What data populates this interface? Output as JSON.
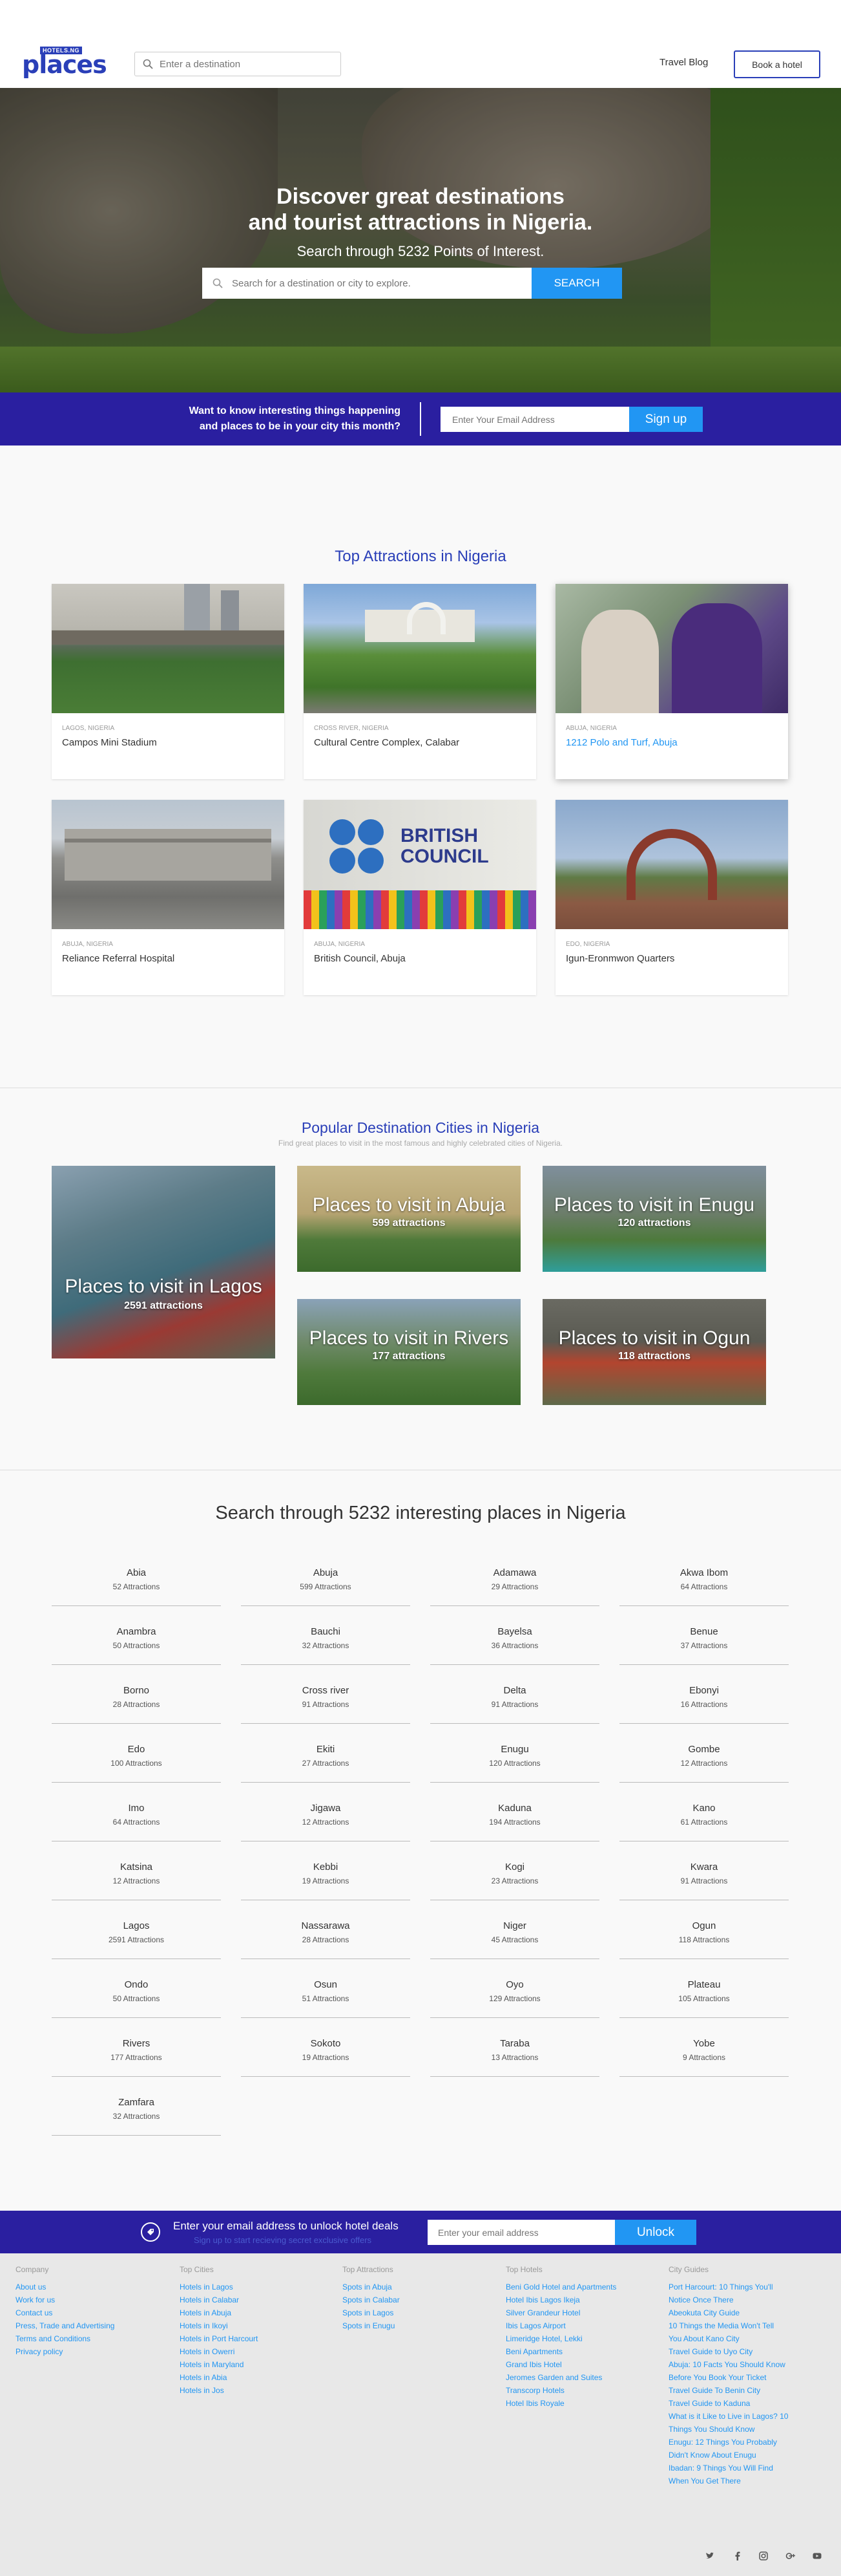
{
  "header": {
    "logo_badge": "HOTELS.NG",
    "logo_text": "places",
    "search_placeholder": "Enter a destination",
    "nav_blog": "Travel Blog",
    "book_hotel": "Book a hotel"
  },
  "hero": {
    "title_line1": "Discover great destinations",
    "title_line2": "and tourist attractions in Nigeria.",
    "subtitle": "Search through 5232 Points of Interest.",
    "search_placeholder": "Search for a destination or city to explore.",
    "search_button": "SEARCH"
  },
  "newsletter": {
    "text_line1": "Want to know interesting things happening",
    "text_line2": "and places to be in your city this month?",
    "input_placeholder": "Enter Your Email Address",
    "button": "Sign up"
  },
  "top_attractions": {
    "title": "Top Attractions in Nigeria",
    "cards": [
      {
        "location": "LAGOS, NIGERIA",
        "name": "Campos Mini Stadium"
      },
      {
        "location": "CROSS RIVER, NIGERIA",
        "name": "Cultural Centre Complex, Calabar"
      },
      {
        "location": "ABUJA, NIGERIA",
        "name": "1212 Polo and Turf, Abuja"
      },
      {
        "location": "ABUJA, NIGERIA",
        "name": "Reliance Referral Hospital"
      },
      {
        "location": "ABUJA, NIGERIA",
        "name": "British Council, Abuja"
      },
      {
        "location": "EDO, NIGERIA",
        "name": "Igun-Eronmwon Quarters"
      }
    ],
    "british_council_sign": "BRITISH COUNCIL"
  },
  "popular_cities": {
    "title": "Popular Destination Cities in Nigeria",
    "subtitle": "Find great places to visit in the most famous and highly celebrated cities of Nigeria.",
    "tiles": [
      {
        "title": "Places to visit in Lagos",
        "count": "2591 attractions"
      },
      {
        "title": "Places to visit in Abuja",
        "count": "599 attractions"
      },
      {
        "title": "Places to visit in Enugu",
        "count": "120 attractions"
      },
      {
        "title": "Places to visit in Rivers",
        "count": "177 attractions"
      },
      {
        "title": "Places to visit in Ogun",
        "count": "118 attractions"
      }
    ]
  },
  "states": {
    "title": "Search through 5232 interesting places in Nigeria",
    "items": [
      {
        "name": "Abia",
        "count": "52 Attractions"
      },
      {
        "name": "Abuja",
        "count": "599 Attractions"
      },
      {
        "name": "Adamawa",
        "count": "29 Attractions"
      },
      {
        "name": "Akwa Ibom",
        "count": "64 Attractions"
      },
      {
        "name": "Anambra",
        "count": "50 Attractions"
      },
      {
        "name": "Bauchi",
        "count": "32 Attractions"
      },
      {
        "name": "Bayelsa",
        "count": "36 Attractions"
      },
      {
        "name": "Benue",
        "count": "37 Attractions"
      },
      {
        "name": "Borno",
        "count": "28 Attractions"
      },
      {
        "name": "Cross river",
        "count": "91 Attractions"
      },
      {
        "name": "Delta",
        "count": "91 Attractions"
      },
      {
        "name": "Ebonyi",
        "count": "16 Attractions"
      },
      {
        "name": "Edo",
        "count": "100 Attractions"
      },
      {
        "name": "Ekiti",
        "count": "27 Attractions"
      },
      {
        "name": "Enugu",
        "count": "120 Attractions"
      },
      {
        "name": "Gombe",
        "count": "12 Attractions"
      },
      {
        "name": "Imo",
        "count": "64 Attractions"
      },
      {
        "name": "Jigawa",
        "count": "12 Attractions"
      },
      {
        "name": "Kaduna",
        "count": "194 Attractions"
      },
      {
        "name": "Kano",
        "count": "61 Attractions"
      },
      {
        "name": "Katsina",
        "count": "12 Attractions"
      },
      {
        "name": "Kebbi",
        "count": "19 Attractions"
      },
      {
        "name": "Kogi",
        "count": "23 Attractions"
      },
      {
        "name": "Kwara",
        "count": "91 Attractions"
      },
      {
        "name": "Lagos",
        "count": "2591 Attractions"
      },
      {
        "name": "Nassarawa",
        "count": "28 Attractions"
      },
      {
        "name": "Niger",
        "count": "45 Attractions"
      },
      {
        "name": "Ogun",
        "count": "118 Attractions"
      },
      {
        "name": "Ondo",
        "count": "50 Attractions"
      },
      {
        "name": "Osun",
        "count": "51 Attractions"
      },
      {
        "name": "Oyo",
        "count": "129 Attractions"
      },
      {
        "name": "Plateau",
        "count": "105 Attractions"
      },
      {
        "name": "Rivers",
        "count": "177 Attractions"
      },
      {
        "name": "Sokoto",
        "count": "19 Attractions"
      },
      {
        "name": "Taraba",
        "count": "13 Attractions"
      },
      {
        "name": "Yobe",
        "count": "9 Attractions"
      },
      {
        "name": "Zamfara",
        "count": "32 Attractions"
      }
    ]
  },
  "unlock": {
    "title": "Enter your email address to unlock hotel deals",
    "subtitle": "Sign up to start recieving secret exclusive offers",
    "input_placeholder": "Enter your email address",
    "button": "Unlock"
  },
  "footer": {
    "company": {
      "title": "Company",
      "links": [
        "About us",
        "Work for us",
        "Contact us",
        "Press, Trade and Advertising",
        "Terms and Conditions",
        "Privacy policy"
      ]
    },
    "top_cities": {
      "title": "Top Cities",
      "links": [
        "Hotels in Lagos",
        "Hotels in Calabar",
        "Hotels in Abuja",
        "Hotels in Ikoyi",
        "Hotels in Port Harcourt",
        "Hotels in Owerri",
        "Hotels in Maryland",
        "Hotels in Abia",
        "Hotels in Jos"
      ]
    },
    "top_attractions": {
      "title": "Top Attractions",
      "links": [
        "Spots in Abuja",
        "Spots in Calabar",
        "Spots in Lagos",
        "Spots in Enugu"
      ]
    },
    "top_hotels": {
      "title": "Top Hotels",
      "links": [
        "Beni Gold Hotel and Apartments",
        "Hotel Ibis Lagos Ikeja",
        "Silver Grandeur Hotel",
        "Ibis Lagos Airport",
        "Limeridge Hotel, Lekki",
        "Beni Apartments",
        "Grand Ibis Hotel",
        "Jeromes Garden and Suites",
        "Transcorp Hotels",
        "Hotel Ibis Royale"
      ]
    },
    "city_guides": {
      "title": "City Guides",
      "links": [
        "Port Harcourt: 10 Things You'll",
        "Notice Once There",
        "Abeokuta City Guide",
        "10 Things the Media Won't Tell",
        "You About Kano City",
        "Travel Guide to Uyo City",
        "Abuja: 10 Facts You Should Know",
        "Before You Book Your Ticket",
        "Travel Guide To Benin City",
        "Travel Guide to Kaduna",
        "What is it Like to Live in Lagos? 10",
        "Things You Should Know",
        "Enugu: 12 Things You Probably",
        "Didn't Know About Enugu",
        "Ibadan: 9 Things You Will Find",
        "When You Get There"
      ]
    },
    "social": [
      "twitter",
      "facebook",
      "instagram",
      "google-plus",
      "youtube"
    ]
  }
}
